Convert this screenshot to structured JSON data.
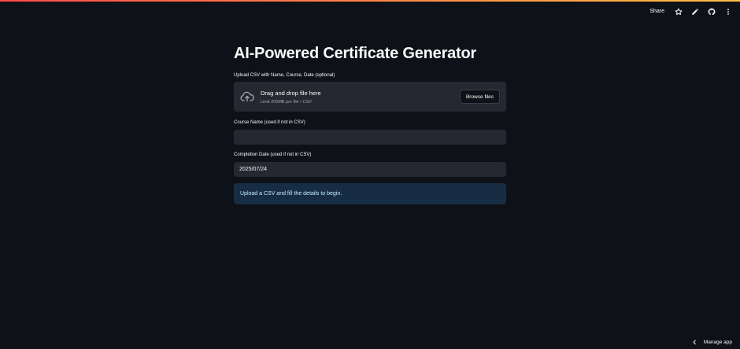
{
  "header": {
    "share_label": "Share",
    "icons": [
      "star-icon",
      "pencil-icon",
      "github-icon",
      "more-vertical-icon"
    ]
  },
  "main": {
    "title": "AI-Powered Certificate Generator",
    "uploader": {
      "label": "Upload CSV with Name, Course, Date (optional)",
      "drop_title": "Drag and drop file here",
      "drop_limit": "Limit 200MB per file • CSV",
      "browse_label": "Browse files",
      "icon": "cloud-upload-icon"
    },
    "course_name": {
      "label": "Course Name (used if not in CSV)",
      "value": ""
    },
    "completion_date": {
      "label": "Completion Date (used if not in CSV)",
      "value": "2025/07/24"
    },
    "info_message": "Upload a CSV and fill the details to begin."
  },
  "footer": {
    "manage_app_label": "Manage app",
    "icon": "chevron-left-icon"
  },
  "colors": {
    "background": "#0e1117",
    "widget_bg": "#262730",
    "info_bg": "#172d43",
    "info_text": "#c7ebff",
    "accent_red": "#ff4b4b",
    "accent_yellow": "#ffbd45"
  }
}
